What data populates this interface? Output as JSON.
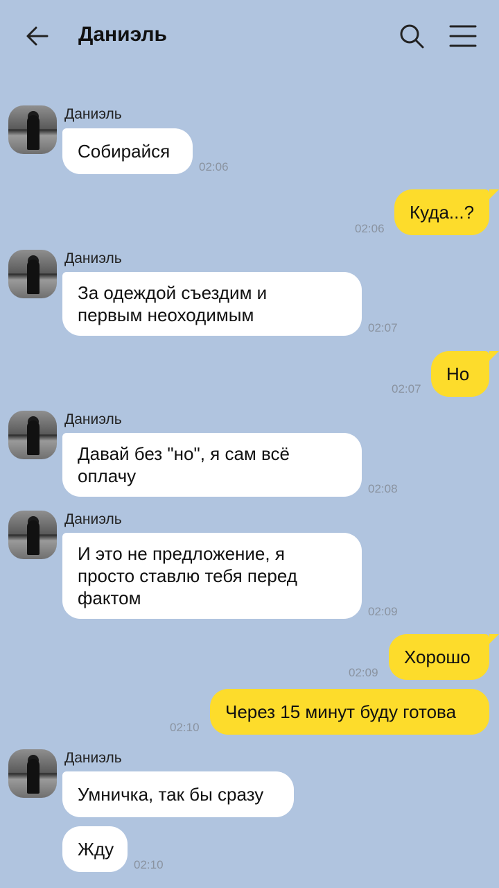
{
  "header": {
    "title": "Даниэль"
  },
  "sender_name": "Даниэль",
  "messages": [
    {
      "text": "Собирайся",
      "time": "02:06"
    },
    {
      "text": "Куда...?",
      "time": "02:06"
    },
    {
      "line1": "За одеждой съездим и",
      "line2": "первым неоходимым",
      "time": "02:07"
    },
    {
      "text": "Но",
      "time": "02:07"
    },
    {
      "line1": "Давай без \"но\", я сам всё",
      "line2": "оплачу",
      "time": "02:08"
    },
    {
      "line1": "И это не предложение, я",
      "line2": "просто ставлю тебя перед",
      "line3": "фактом",
      "time": "02:09"
    },
    {
      "text": "Хорошо",
      "time": "02:09"
    },
    {
      "text": "Через 15 минут буду готова",
      "time": "02:10"
    },
    {
      "text": "Умничка, так бы сразу"
    },
    {
      "text": "Жду",
      "time": "02:10"
    }
  ]
}
